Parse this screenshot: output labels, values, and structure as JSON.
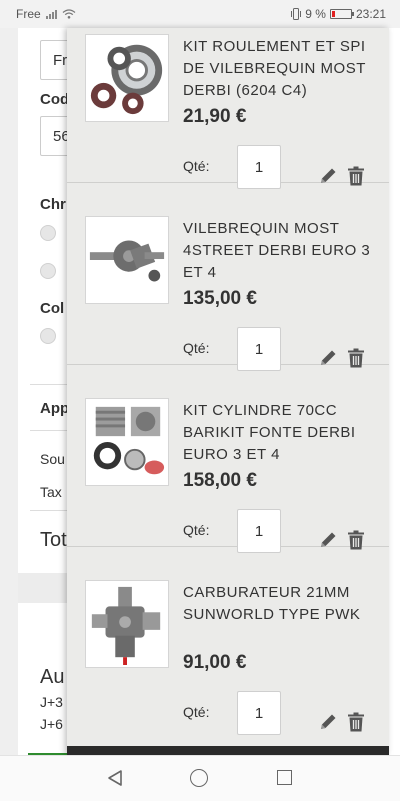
{
  "status_bar": {
    "carrier": "Free",
    "battery": "9 %",
    "time": "23:21"
  },
  "background": {
    "input_1": "Fr",
    "label_code": "Cod",
    "input_2": "56",
    "label_chr": "Chr",
    "label_col": "Col",
    "label_app": "App",
    "row_sou": "Sou",
    "row_tax": "Tax",
    "total": "Tot",
    "label_au": "Au",
    "line_j3": "J+3",
    "line_j6": "J+6"
  },
  "cart": {
    "qty_label": "Qté:",
    "items": [
      {
        "title": "KIT ROULEMENT ET SPI DE VILEBREQUIN MOST DERBI (6204 C4)",
        "price": "21,90 €",
        "qty": "1",
        "image": "bearing-kit-image"
      },
      {
        "title": "VILEBREQUIN MOST 4STREET DERBI EURO 3 ET 4",
        "price": "135,00 €",
        "qty": "1",
        "image": "crankshaft-image"
      },
      {
        "title": "KIT CYLINDRE 70CC BARIKIT FONTE DERBI EURO 3 ET 4",
        "price": "158,00 €",
        "qty": "1",
        "image": "cylinder-kit-image"
      },
      {
        "title": "CARBURATEUR 21MM SUNWORLD TYPE PWK",
        "price": "91,00 €",
        "qty": "1",
        "image": "carburetor-image"
      }
    ]
  },
  "icons": {
    "edit": "pencil-icon",
    "delete": "trash-icon",
    "back": "back-triangle-icon",
    "home": "home-circle-icon",
    "recent": "recent-apps-icon"
  }
}
